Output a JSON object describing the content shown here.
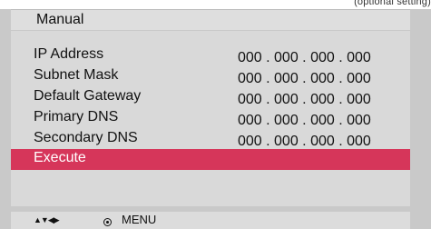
{
  "top_note": "(optional setting)",
  "header": {
    "title": "Manual"
  },
  "rows": [
    {
      "label": "IP Address",
      "value": "000 . 000 . 000 . 000"
    },
    {
      "label": "Subnet Mask",
      "value": "000 . 000 . 000 . 000"
    },
    {
      "label": "Default Gateway",
      "value": "000 . 000 . 000 . 000"
    },
    {
      "label": "Primary DNS",
      "value": "000 . 000 . 000 . 000"
    },
    {
      "label": "Secondary DNS",
      "value": "000 . 000 . 000 . 000"
    },
    {
      "label": "Execute",
      "value": ""
    }
  ],
  "footer": {
    "nav_icon": "arrow-keys-icon",
    "nav_glyphs": "▲▼◀▶",
    "ok_icon": "ok-button-icon",
    "menu_label": "MENU"
  },
  "colors": {
    "panel_bg": "#c9c9c9",
    "content_bg": "#d9d9d9",
    "selected_bg": "#d6365a",
    "selected_text": "#ffffff"
  }
}
